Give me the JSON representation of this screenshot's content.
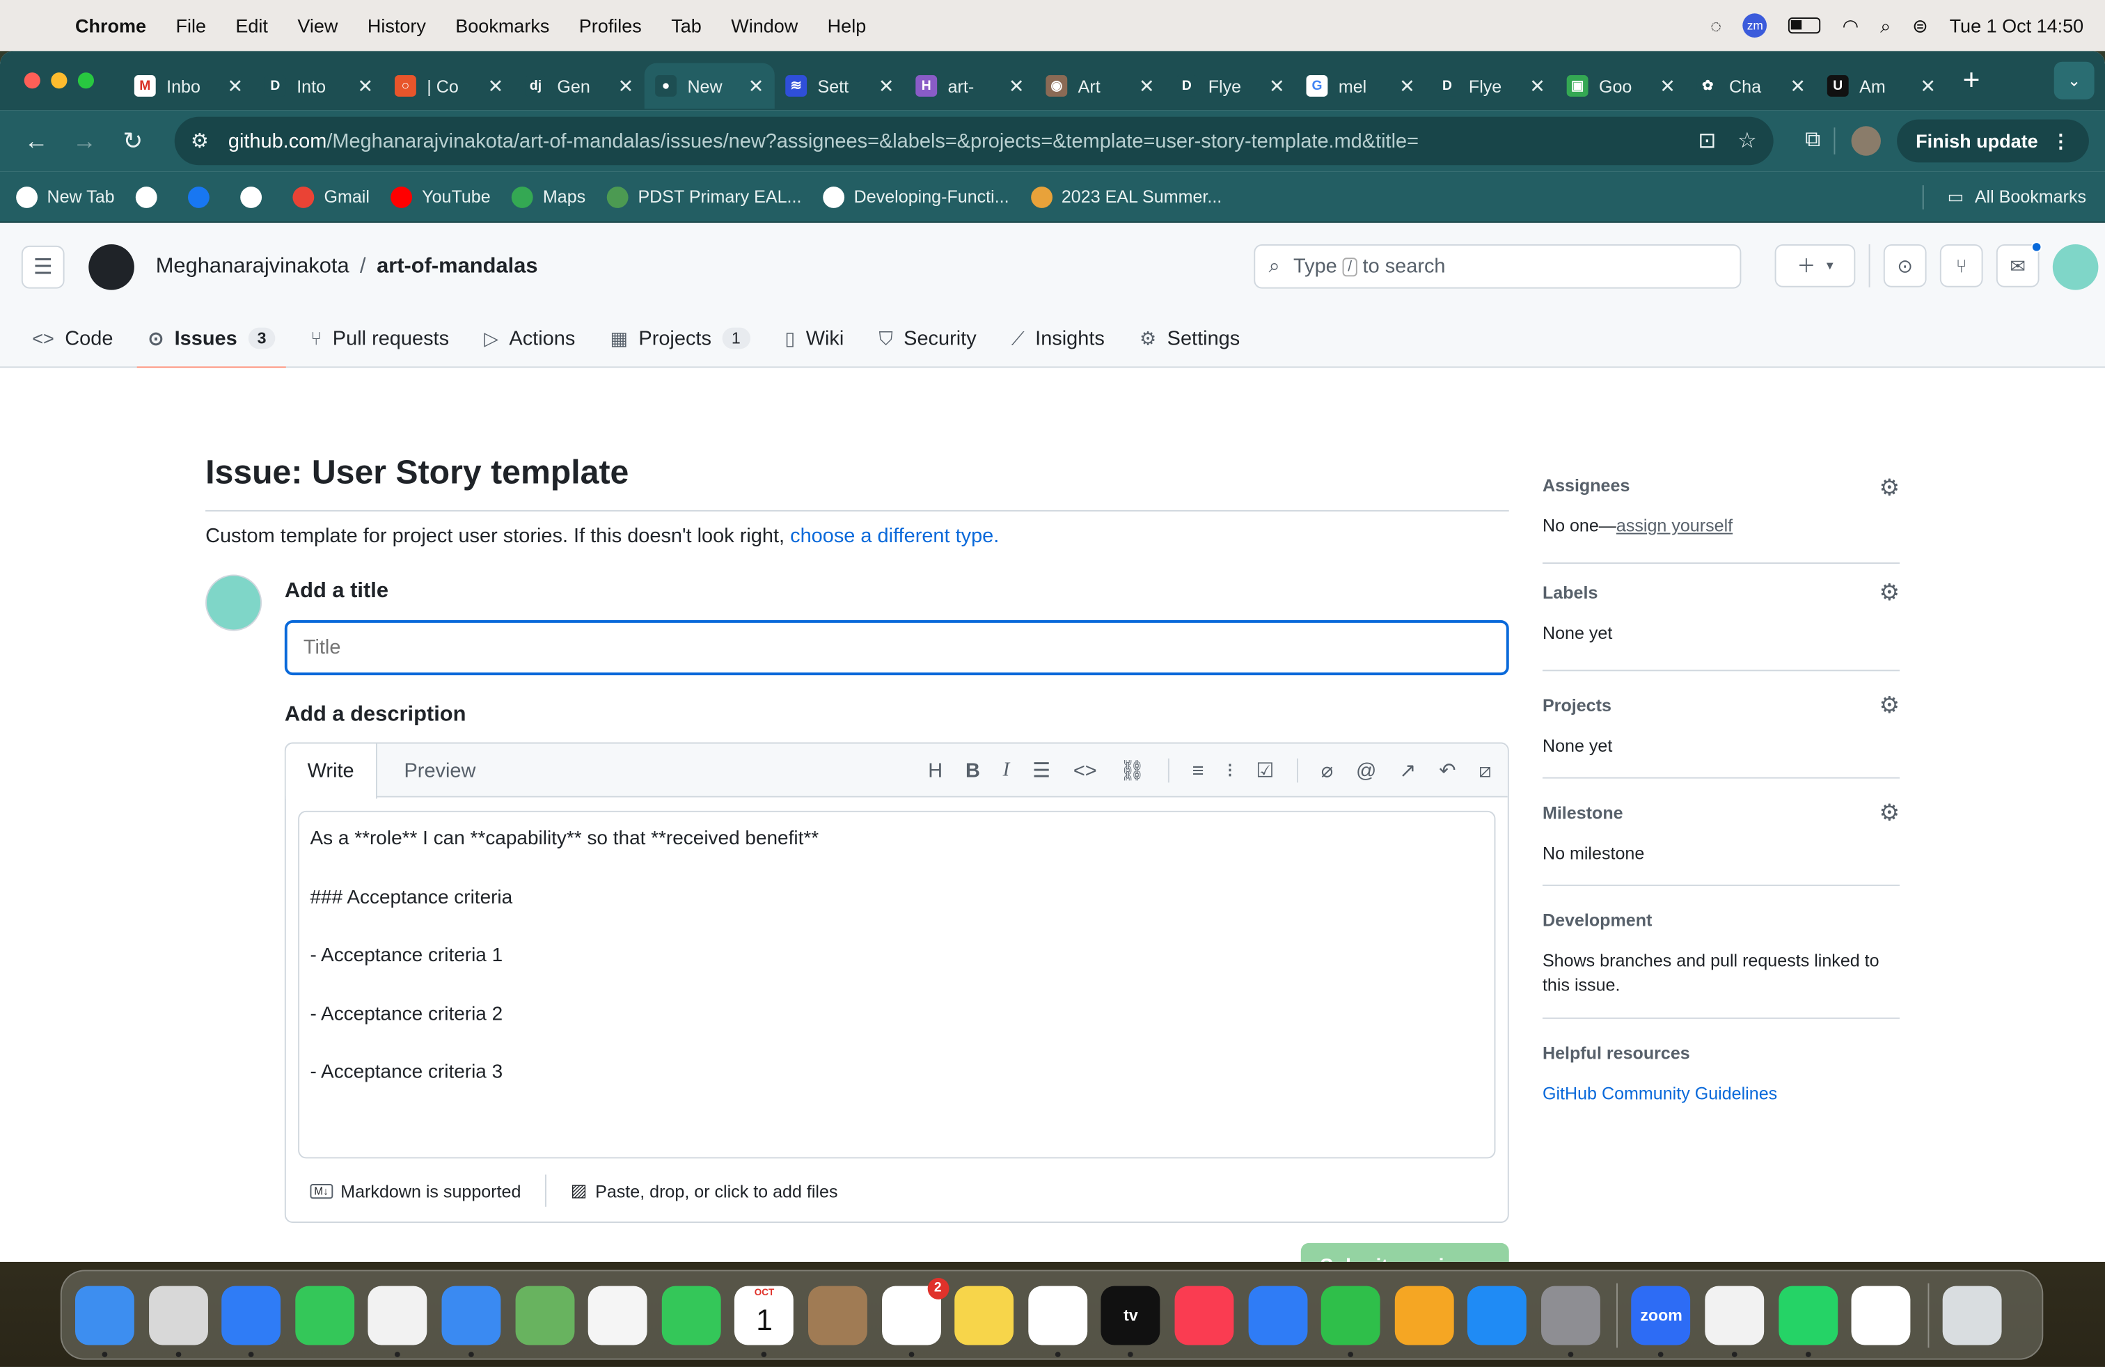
{
  "menubar": {
    "app": "Chrome",
    "items": [
      "File",
      "Edit",
      "View",
      "History",
      "Bookmarks",
      "Profiles",
      "Tab",
      "Window",
      "Help"
    ],
    "clock": "Tue 1 Oct  14:50",
    "zm": "zm"
  },
  "tabs": [
    {
      "label": "Inbo",
      "fav": "M",
      "color": "#ffffff",
      "fg": "#d93025"
    },
    {
      "label": "Into",
      "fav": "D",
      "color": "#1d4e52",
      "fg": "#ffffff"
    },
    {
      "label": "| Co",
      "fav": "○",
      "color": "#e8552b",
      "fg": "#ffffff"
    },
    {
      "label": "Gen",
      "fav": "dj",
      "color": "#1d4e52",
      "fg": "#ffffff"
    },
    {
      "label": "New",
      "fav": "●",
      "color": "#1d4e52",
      "fg": "#ffffff",
      "active": true
    },
    {
      "label": "Sett",
      "fav": "≋",
      "color": "#2f4fd9",
      "fg": "#ffffff"
    },
    {
      "label": "art-",
      "fav": "H",
      "color": "#8a5cc7",
      "fg": "#ffffff"
    },
    {
      "label": "Art",
      "fav": "◉",
      "color": "#8a6a55",
      "fg": "#ffffff"
    },
    {
      "label": "Flye",
      "fav": "D",
      "color": "#1d4e52",
      "fg": "#ffffff"
    },
    {
      "label": "mel",
      "fav": "G",
      "color": "#ffffff",
      "fg": "#4285f4"
    },
    {
      "label": "Flye",
      "fav": "D",
      "color": "#1d4e52",
      "fg": "#ffffff"
    },
    {
      "label": "Goo",
      "fav": "▣",
      "color": "#34a853",
      "fg": "#ffffff"
    },
    {
      "label": "Cha",
      "fav": "✿",
      "color": "#1d4e52",
      "fg": "#ffffff"
    },
    {
      "label": "Am",
      "fav": "U",
      "color": "#111111",
      "fg": "#ffffff"
    }
  ],
  "omnibox": {
    "host": "github.com",
    "path": "/Meghanarajvinakota/art-of-mandalas/issues/new?assignees=&labels=&projects=&template=user-story-template.md&title="
  },
  "finish_update": "Finish update",
  "bookmarks": [
    {
      "label": "New Tab",
      "color": "#ffffff"
    },
    {
      "label": "",
      "color": "#ffffff"
    },
    {
      "label": "",
      "color": "#1877f2"
    },
    {
      "label": "",
      "color": "#ffffff"
    },
    {
      "label": "Gmail",
      "color": "#ea4335"
    },
    {
      "label": "YouTube",
      "color": "#ff0000"
    },
    {
      "label": "Maps",
      "color": "#34a853"
    },
    {
      "label": "PDST Primary EAL...",
      "color": "#4c9a52"
    },
    {
      "label": "Developing-Functi...",
      "color": "#ffffff"
    },
    {
      "label": "2023 EAL Summer...",
      "color": "#e8a23a"
    }
  ],
  "all_bookmarks": "All Bookmarks",
  "repo": {
    "owner": "Meghanarajvinakota",
    "sep": "/",
    "name": "art-of-mandalas"
  },
  "search_placeholder_a": "Type",
  "search_key": "/",
  "search_placeholder_b": "to search",
  "repo_nav": [
    {
      "label": "Code",
      "icon": "<>"
    },
    {
      "label": "Issues",
      "icon": "⊙",
      "count": "3",
      "active": true
    },
    {
      "label": "Pull requests",
      "icon": "⑂"
    },
    {
      "label": "Actions",
      "icon": "▷"
    },
    {
      "label": "Projects",
      "icon": "▦",
      "count": "1"
    },
    {
      "label": "Wiki",
      "icon": "▯"
    },
    {
      "label": "Security",
      "icon": "⛉"
    },
    {
      "label": "Insights",
      "icon": "⟋"
    },
    {
      "label": "Settings",
      "icon": "⚙"
    }
  ],
  "issue": {
    "heading": "Issue: User Story template",
    "subtitle_text": "Custom template for project user stories. If this doesn't look right, ",
    "subtitle_link": "choose a different type.",
    "title_label": "Add a title",
    "title_placeholder": "Title",
    "desc_label": "Add a description",
    "tab_write": "Write",
    "tab_preview": "Preview",
    "body": "As a **role** I can **capability** so that **received benefit**\n\n### Acceptance criteria\n\n- Acceptance criteria 1\n\n- Acceptance criteria 2\n\n- Acceptance criteria 3",
    "markdown_note": "Markdown is supported",
    "attach_note": "Paste, drop, or click to add files",
    "submit": "Submit new issue"
  },
  "sidebar": {
    "assignees": {
      "title": "Assignees",
      "text": "No one—",
      "link": "assign yourself"
    },
    "labels": {
      "title": "Labels",
      "text": "None yet"
    },
    "projects": {
      "title": "Projects",
      "text": "None yet"
    },
    "milestone": {
      "title": "Milestone",
      "text": "No milestone"
    },
    "development": {
      "title": "Development",
      "text": "Shows branches and pull requests linked to this issue."
    },
    "helpful": {
      "title": "Helpful resources",
      "link": "GitHub Community Guidelines"
    }
  },
  "dock": [
    {
      "name": "finder",
      "color": "#3d8ef0"
    },
    {
      "name": "launchpad",
      "color": "#d8d8d8"
    },
    {
      "name": "safari",
      "color": "#2f7cf6"
    },
    {
      "name": "messages",
      "color": "#34c759"
    },
    {
      "name": "chrome",
      "color": "#f2f2f2"
    },
    {
      "name": "mail",
      "color": "#3a8af2"
    },
    {
      "name": "maps",
      "color": "#68b35f"
    },
    {
      "name": "photos",
      "color": "#f5f5f5"
    },
    {
      "name": "facetime",
      "color": "#34c759"
    },
    {
      "name": "calendar",
      "color": "#ffffff",
      "label": "1",
      "sub": "OCT"
    },
    {
      "name": "contacts",
      "color": "#a07b54"
    },
    {
      "name": "reminders",
      "color": "#ffffff",
      "badge": "2"
    },
    {
      "name": "notes",
      "color": "#f7d54a"
    },
    {
      "name": "freeform",
      "color": "#ffffff"
    },
    {
      "name": "tv",
      "color": "#111111",
      "label": "tv"
    },
    {
      "name": "music",
      "color": "#fa3c51"
    },
    {
      "name": "keynote",
      "color": "#2f7cf6"
    },
    {
      "name": "numbers",
      "color": "#2fbf4a"
    },
    {
      "name": "pages",
      "color": "#f5a623"
    },
    {
      "name": "app-store",
      "color": "#1f8bf5"
    },
    {
      "name": "system-settings",
      "color": "#8e8e93"
    },
    {
      "name": "zoom",
      "color": "#2d6cf5",
      "label": "zoom"
    },
    {
      "name": "chrome-2",
      "color": "#f2f2f2"
    },
    {
      "name": "whatsapp",
      "color": "#25d366"
    },
    {
      "name": "slack",
      "color": "#ffffff"
    },
    {
      "name": "trash",
      "color": "#d9dde0"
    }
  ]
}
